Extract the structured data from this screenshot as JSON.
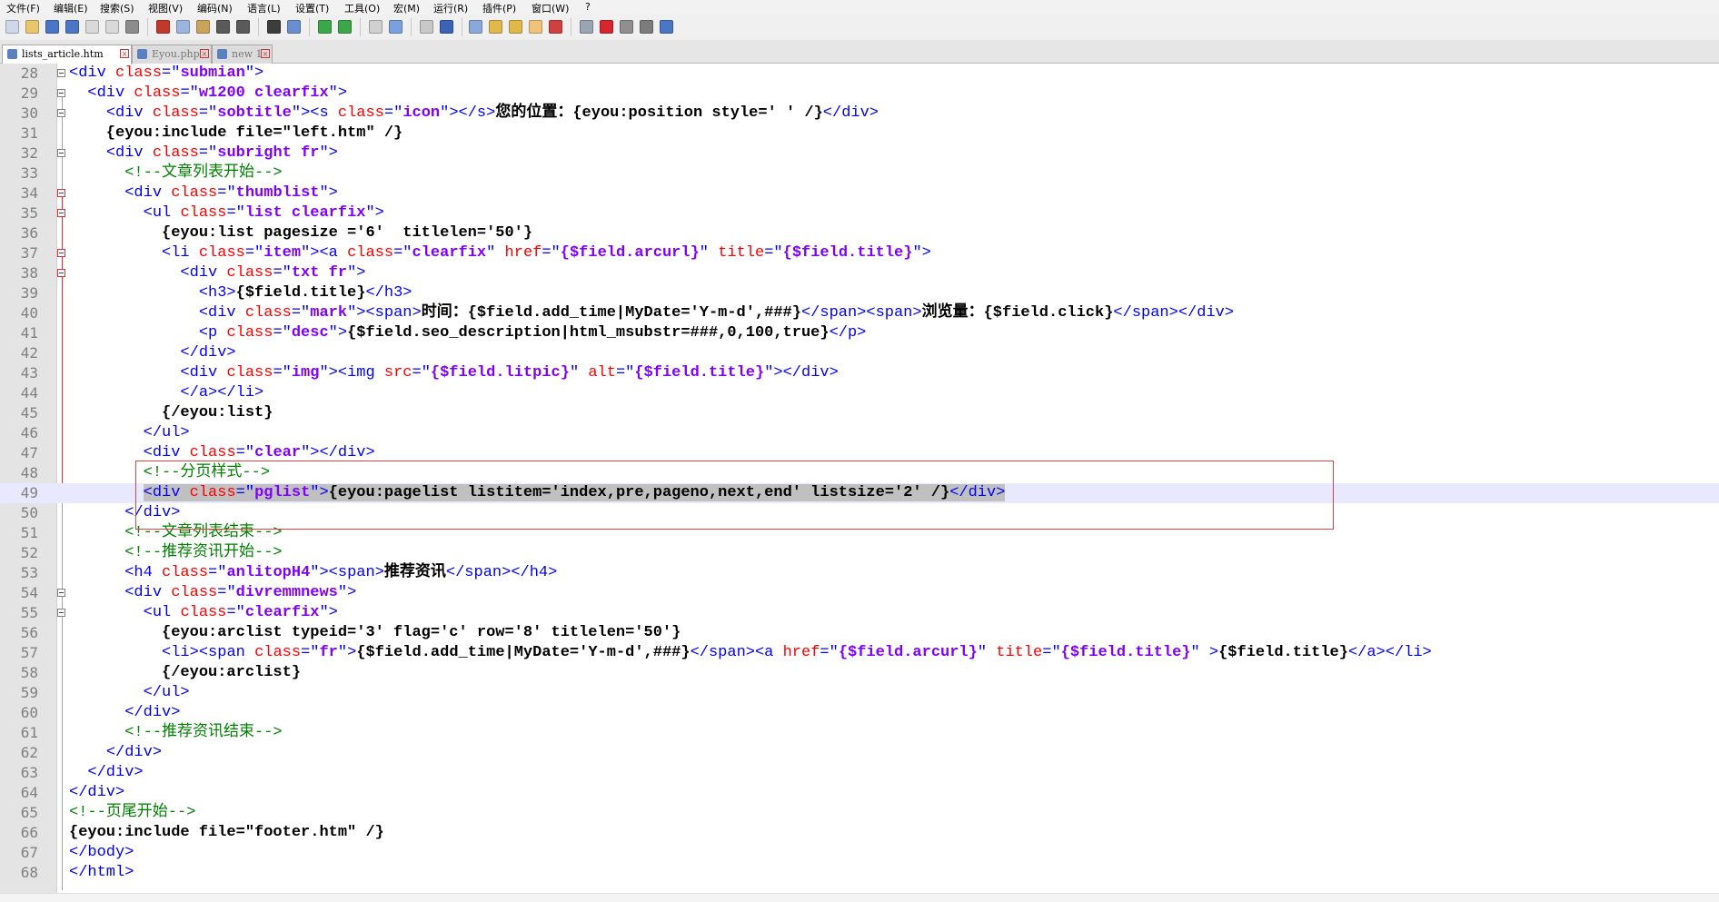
{
  "menu": [
    "文件(F)",
    "编辑(E)",
    "搜索(S)",
    "视图(V)",
    "编码(N)",
    "语言(L)",
    "设置(T)",
    "工具(O)",
    "宏(M)",
    "运行(R)",
    "插件(P)",
    "窗口(W)",
    "?"
  ],
  "toolbar_icons": [
    "new-file-icon",
    "open-file-icon",
    "save-icon",
    "save-all-icon",
    "close-icon",
    "close-all-icon",
    "print-icon",
    "cut-icon",
    "copy-icon",
    "paste-icon",
    "undo-icon",
    "redo-icon",
    "find-icon",
    "replace-icon",
    "zoom-in-icon",
    "zoom-out-icon",
    "sync-vertical-icon",
    "sync-horizontal-icon",
    "word-wrap-icon",
    "show-all-chars-icon",
    "indent-guide-icon",
    "doc-map-icon",
    "function-list-icon",
    "folder-workspace-icon",
    "monitor-icon",
    "record-macro-icon",
    "stop-macro-icon",
    "play-macro-icon",
    "run-macro-multiple-icon",
    "save-macro-icon"
  ],
  "tabs": [
    {
      "label": "lists_article.htm",
      "active": true
    },
    {
      "label": "Eyou.php",
      "active": false
    },
    {
      "label": "new 1",
      "active": false
    }
  ],
  "editor": {
    "current_line": 49,
    "lines": [
      {
        "n": "28",
        "tokens": [
          [
            "t",
            "<div "
          ],
          [
            "a",
            "class"
          ],
          [
            "t",
            "=\""
          ],
          [
            "v",
            "submian"
          ],
          [
            "t",
            "\">"
          ]
        ]
      },
      {
        "n": "29",
        "tokens": [
          [
            "x",
            "  "
          ],
          [
            "t",
            "<div "
          ],
          [
            "a",
            "class"
          ],
          [
            "t",
            "=\""
          ],
          [
            "v",
            "w1200 clearfix"
          ],
          [
            "t",
            "\">"
          ]
        ]
      },
      {
        "n": "30",
        "tokens": [
          [
            "x",
            "    "
          ],
          [
            "t",
            "<div "
          ],
          [
            "a",
            "class"
          ],
          [
            "t",
            "=\""
          ],
          [
            "v",
            "sobtitle"
          ],
          [
            "t",
            "\"><s "
          ],
          [
            "a",
            "class"
          ],
          [
            "t",
            "=\""
          ],
          [
            "v",
            "icon"
          ],
          [
            "t",
            "\"></s>"
          ],
          [
            "x",
            "您的位置：{eyou:position style=' ' /}"
          ],
          [
            "t",
            "</div>"
          ]
        ]
      },
      {
        "n": "31",
        "tokens": [
          [
            "x",
            "    {eyou:include file=\"left.htm\" /}"
          ]
        ]
      },
      {
        "n": "32",
        "tokens": [
          [
            "x",
            "    "
          ],
          [
            "t",
            "<div "
          ],
          [
            "a",
            "class"
          ],
          [
            "t",
            "=\""
          ],
          [
            "v",
            "subright fr"
          ],
          [
            "t",
            "\">"
          ]
        ]
      },
      {
        "n": "33",
        "tokens": [
          [
            "x",
            "      "
          ],
          [
            "c",
            "<!--文章列表开始-->"
          ]
        ]
      },
      {
        "n": "34",
        "tokens": [
          [
            "x",
            "      "
          ],
          [
            "t",
            "<div "
          ],
          [
            "a",
            "class"
          ],
          [
            "t",
            "=\""
          ],
          [
            "v",
            "thumblist"
          ],
          [
            "t",
            "\">"
          ]
        ]
      },
      {
        "n": "35",
        "tokens": [
          [
            "x",
            "        "
          ],
          [
            "t",
            "<ul "
          ],
          [
            "a",
            "class"
          ],
          [
            "t",
            "=\""
          ],
          [
            "v",
            "list clearfix"
          ],
          [
            "t",
            "\">"
          ]
        ]
      },
      {
        "n": "36",
        "tokens": [
          [
            "x",
            "          {eyou:list pagesize ='6'  titlelen='50'}"
          ]
        ]
      },
      {
        "n": "37",
        "tokens": [
          [
            "x",
            "          "
          ],
          [
            "t",
            "<li "
          ],
          [
            "a",
            "class"
          ],
          [
            "t",
            "=\""
          ],
          [
            "v",
            "item"
          ],
          [
            "t",
            "\"><a "
          ],
          [
            "a",
            "class"
          ],
          [
            "t",
            "=\""
          ],
          [
            "v",
            "clearfix"
          ],
          [
            "t",
            "\" "
          ],
          [
            "a",
            "href"
          ],
          [
            "t",
            "=\""
          ],
          [
            "v",
            "{$field.arcurl}"
          ],
          [
            "t",
            "\" "
          ],
          [
            "a",
            "title"
          ],
          [
            "t",
            "=\""
          ],
          [
            "v",
            "{$field.title}"
          ],
          [
            "t",
            "\">"
          ]
        ]
      },
      {
        "n": "38",
        "tokens": [
          [
            "x",
            "            "
          ],
          [
            "t",
            "<div "
          ],
          [
            "a",
            "class"
          ],
          [
            "t",
            "=\""
          ],
          [
            "v",
            "txt fr"
          ],
          [
            "t",
            "\">"
          ]
        ]
      },
      {
        "n": "39",
        "tokens": [
          [
            "x",
            "              "
          ],
          [
            "t",
            "<h3>"
          ],
          [
            "x",
            "{$field.title}"
          ],
          [
            "t",
            "</h3>"
          ]
        ]
      },
      {
        "n": "40",
        "tokens": [
          [
            "x",
            "              "
          ],
          [
            "t",
            "<div "
          ],
          [
            "a",
            "class"
          ],
          [
            "t",
            "=\""
          ],
          [
            "v",
            "mark"
          ],
          [
            "t",
            "\"><span>"
          ],
          [
            "x",
            "时间：{$field.add_time|MyDate='Y-m-d',###}"
          ],
          [
            "t",
            "</span><span>"
          ],
          [
            "x",
            "浏览量：{$field.click}"
          ],
          [
            "t",
            "</span></div>"
          ]
        ]
      },
      {
        "n": "41",
        "tokens": [
          [
            "x",
            "              "
          ],
          [
            "t",
            "<p "
          ],
          [
            "a",
            "class"
          ],
          [
            "t",
            "=\""
          ],
          [
            "v",
            "desc"
          ],
          [
            "t",
            "\">"
          ],
          [
            "x",
            "{$field.seo_description|html_msubstr=###,0,100,true}"
          ],
          [
            "t",
            "</p>"
          ]
        ]
      },
      {
        "n": "42",
        "tokens": [
          [
            "x",
            "            "
          ],
          [
            "t",
            "</div>"
          ]
        ]
      },
      {
        "n": "43",
        "tokens": [
          [
            "x",
            "            "
          ],
          [
            "t",
            "<div "
          ],
          [
            "a",
            "class"
          ],
          [
            "t",
            "=\""
          ],
          [
            "v",
            "img"
          ],
          [
            "t",
            "\"><img "
          ],
          [
            "a",
            "src"
          ],
          [
            "t",
            "=\""
          ],
          [
            "v",
            "{$field.litpic}"
          ],
          [
            "t",
            "\" "
          ],
          [
            "a",
            "alt"
          ],
          [
            "t",
            "=\""
          ],
          [
            "v",
            "{$field.title}"
          ],
          [
            "t",
            "\"></div>"
          ]
        ]
      },
      {
        "n": "44",
        "tokens": [
          [
            "x",
            "            "
          ],
          [
            "t",
            "</a></li>"
          ]
        ]
      },
      {
        "n": "45",
        "tokens": [
          [
            "x",
            "          {/eyou:list}"
          ]
        ]
      },
      {
        "n": "46",
        "tokens": [
          [
            "x",
            "        "
          ],
          [
            "t",
            "</ul>"
          ]
        ]
      },
      {
        "n": "47",
        "tokens": [
          [
            "x",
            "        "
          ],
          [
            "t",
            "<div "
          ],
          [
            "a",
            "class"
          ],
          [
            "t",
            "=\""
          ],
          [
            "v",
            "clear"
          ],
          [
            "t",
            "\"></div>"
          ]
        ]
      },
      {
        "n": "48",
        "tokens": [
          [
            "x",
            "        "
          ],
          [
            "c",
            "<!--分页样式-->"
          ]
        ]
      },
      {
        "n": "49",
        "tokens": [
          [
            "x",
            "        "
          ],
          [
            "t",
            "<div "
          ],
          [
            "a",
            "class"
          ],
          [
            "t",
            "=\""
          ],
          [
            "v",
            "pglist"
          ],
          [
            "t",
            "\">"
          ],
          [
            "x",
            "{eyou:pagelist listitem='index,pre,pageno,next,end' listsize='2' /}"
          ],
          [
            "t",
            "</div>"
          ]
        ]
      },
      {
        "n": "50",
        "tokens": [
          [
            "x",
            "      "
          ],
          [
            "t",
            "</div>"
          ]
        ]
      },
      {
        "n": "51",
        "tokens": [
          [
            "x",
            "      "
          ],
          [
            "c",
            "<!--文章列表结束-->"
          ]
        ]
      },
      {
        "n": "52",
        "tokens": [
          [
            "x",
            "      "
          ],
          [
            "c",
            "<!--推荐资讯开始-->"
          ]
        ]
      },
      {
        "n": "53",
        "tokens": [
          [
            "x",
            "      "
          ],
          [
            "t",
            "<h4 "
          ],
          [
            "a",
            "class"
          ],
          [
            "t",
            "=\""
          ],
          [
            "v",
            "anlitopH4"
          ],
          [
            "t",
            "\"><span>"
          ],
          [
            "x",
            "推荐资讯"
          ],
          [
            "t",
            "</span></h4>"
          ]
        ]
      },
      {
        "n": "54",
        "tokens": [
          [
            "x",
            "      "
          ],
          [
            "t",
            "<div "
          ],
          [
            "a",
            "class"
          ],
          [
            "t",
            "=\""
          ],
          [
            "v",
            "divremmnews"
          ],
          [
            "t",
            "\">"
          ]
        ]
      },
      {
        "n": "55",
        "tokens": [
          [
            "x",
            "        "
          ],
          [
            "t",
            "<ul "
          ],
          [
            "a",
            "class"
          ],
          [
            "t",
            "=\""
          ],
          [
            "v",
            "clearfix"
          ],
          [
            "t",
            "\">"
          ]
        ]
      },
      {
        "n": "56",
        "tokens": [
          [
            "x",
            "          {eyou:arclist typeid='3' flag='c' row='8' titlelen='50'}"
          ]
        ]
      },
      {
        "n": "57",
        "tokens": [
          [
            "x",
            "          "
          ],
          [
            "t",
            "<li><span "
          ],
          [
            "a",
            "class"
          ],
          [
            "t",
            "=\""
          ],
          [
            "v",
            "fr"
          ],
          [
            "t",
            "\">"
          ],
          [
            "x",
            "{$field.add_time|MyDate='Y-m-d',###}"
          ],
          [
            "t",
            "</span><a "
          ],
          [
            "a",
            "href"
          ],
          [
            "t",
            "=\""
          ],
          [
            "v",
            "{$field.arcurl}"
          ],
          [
            "t",
            "\" "
          ],
          [
            "a",
            "title"
          ],
          [
            "t",
            "=\""
          ],
          [
            "v",
            "{$field.title}"
          ],
          [
            "t",
            "\" >"
          ],
          [
            "x",
            "{$field.title}"
          ],
          [
            "t",
            "</a></li>"
          ]
        ]
      },
      {
        "n": "58",
        "tokens": [
          [
            "x",
            "          {/eyou:arclist}"
          ]
        ]
      },
      {
        "n": "59",
        "tokens": [
          [
            "x",
            "        "
          ],
          [
            "t",
            "</ul>"
          ]
        ]
      },
      {
        "n": "60",
        "tokens": [
          [
            "x",
            "      "
          ],
          [
            "t",
            "</div>"
          ]
        ]
      },
      {
        "n": "61",
        "tokens": [
          [
            "x",
            "      "
          ],
          [
            "c",
            "<!--推荐资讯结束-->"
          ]
        ]
      },
      {
        "n": "62",
        "tokens": [
          [
            "x",
            "    "
          ],
          [
            "t",
            "</div>"
          ]
        ]
      },
      {
        "n": "63",
        "tokens": [
          [
            "x",
            "  "
          ],
          [
            "t",
            "</div>"
          ]
        ]
      },
      {
        "n": "64",
        "tokens": [
          [
            "t",
            "</div>"
          ]
        ]
      },
      {
        "n": "65",
        "tokens": [
          [
            "c",
            "<!--页尾开始-->"
          ]
        ]
      },
      {
        "n": "66",
        "tokens": [
          [
            "x",
            "{eyou:include file=\"footer.htm\" /}"
          ]
        ]
      },
      {
        "n": "67",
        "tokens": [
          [
            "t",
            "</body>"
          ]
        ]
      },
      {
        "n": "68",
        "tokens": [
          [
            "t",
            "</html>"
          ]
        ]
      }
    ]
  }
}
